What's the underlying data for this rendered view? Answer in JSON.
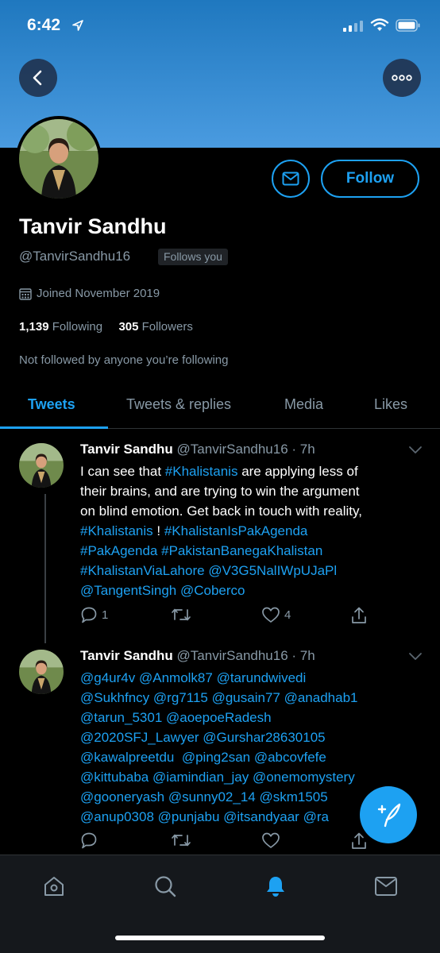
{
  "status_bar": {
    "time": "6:42"
  },
  "profile": {
    "name": "Tanvir Sandhu",
    "handle": "@TanvirSandhu16",
    "follows_you": "Follows you",
    "joined": "Joined November 2019",
    "following_count": "1,139",
    "following_label": "Following",
    "followers_count": "305",
    "followers_label": "Followers",
    "not_followed": "Not followed by anyone you’re following",
    "follow_button": "Follow"
  },
  "tabs": [
    {
      "label": "Tweets",
      "active": true
    },
    {
      "label": "Tweets & replies",
      "active": false
    },
    {
      "label": "Media",
      "active": false
    },
    {
      "label": "Likes",
      "active": false
    }
  ],
  "tweets": [
    {
      "author": "Tanvir Sandhu",
      "handle": "@TanvirSandhu16",
      "time": "· 7h",
      "lines": [
        [
          {
            "t": "I can see that "
          },
          {
            "t": "#Khalistanis",
            "link": true
          },
          {
            "t": " are applying less of"
          }
        ],
        [
          {
            "t": "their brains, and are trying to win the argument"
          }
        ],
        [
          {
            "t": "on blind emotion. Get back in touch with reality,"
          }
        ],
        [
          {
            "t": "#Khalistanis",
            "link": true
          },
          {
            "t": " ! "
          },
          {
            "t": "#KhalistanIsPakAgenda",
            "link": true
          }
        ],
        [
          {
            "t": "#PakAgenda",
            "link": true
          },
          {
            "t": " "
          },
          {
            "t": "#PakistanBanegaKhalistan",
            "link": true
          }
        ],
        [
          {
            "t": "#KhalistanViaLahore",
            "link": true
          },
          {
            "t": " "
          },
          {
            "t": "@V3G5NalIWpUJaPl",
            "link": true
          }
        ],
        [
          {
            "t": "@TangentSingh",
            "link": true
          },
          {
            "t": " "
          },
          {
            "t": "@Coberco",
            "link": true
          }
        ]
      ],
      "reply_count": "1",
      "retweet_count": "",
      "like_count": "4"
    },
    {
      "author": "Tanvir Sandhu",
      "handle": "@TanvirSandhu16",
      "time": "· 7h",
      "lines": [
        [
          {
            "t": "@g4ur4v",
            "link": true
          },
          {
            "t": " "
          },
          {
            "t": "@Anmolk87",
            "link": true
          },
          {
            "t": " "
          },
          {
            "t": "@tarundwivedi",
            "link": true
          }
        ],
        [
          {
            "t": "@Sukhfncy",
            "link": true
          },
          {
            "t": " "
          },
          {
            "t": "@rg7115",
            "link": true
          },
          {
            "t": " "
          },
          {
            "t": "@gusain77",
            "link": true
          },
          {
            "t": " "
          },
          {
            "t": "@anadhab1",
            "link": true
          }
        ],
        [
          {
            "t": "@tarun_5301",
            "link": true
          },
          {
            "t": " "
          },
          {
            "t": "@aoepoeRadesh",
            "link": true
          }
        ],
        [
          {
            "t": "@2020SFJ_Lawyer",
            "link": true
          },
          {
            "t": " "
          },
          {
            "t": "@Gurshar28630105",
            "link": true
          }
        ],
        [
          {
            "t": "@kawalpreetdu",
            "link": true
          },
          {
            "t": "  "
          },
          {
            "t": "@ping2san",
            "link": true
          },
          {
            "t": " "
          },
          {
            "t": "@abcovfefe",
            "link": true
          }
        ],
        [
          {
            "t": "@kittubaba",
            "link": true
          },
          {
            "t": " "
          },
          {
            "t": "@iamindian_jay",
            "link": true
          },
          {
            "t": " "
          },
          {
            "t": "@onemomystery",
            "link": true
          }
        ],
        [
          {
            "t": "@gooneryash",
            "link": true
          },
          {
            "t": " "
          },
          {
            "t": "@sunny02_14",
            "link": true
          },
          {
            "t": " "
          },
          {
            "t": "@skm1505",
            "link": true
          }
        ],
        [
          {
            "t": "@anup0308",
            "link": true
          },
          {
            "t": " "
          },
          {
            "t": "@punjabu",
            "link": true
          },
          {
            "t": " "
          },
          {
            "t": "@itsandyaar",
            "link": true
          },
          {
            "t": " "
          },
          {
            "t": "@ra",
            "link": true
          }
        ]
      ],
      "reply_count": "",
      "retweet_count": "",
      "like_count": ""
    }
  ],
  "colors": {
    "accent": "#1da1f2",
    "background": "#000000",
    "secondary_text": "#8899a6",
    "banner": "#3d8fd6"
  },
  "icons": {
    "back": "chevron-left-icon",
    "more": "more-dots-icon",
    "message": "envelope-icon",
    "calendar": "calendar-icon",
    "reply": "reply-icon",
    "retweet": "retweet-icon",
    "like": "heart-icon",
    "share": "share-icon",
    "compose": "compose-tweet-icon",
    "nav": [
      "home-icon",
      "search-icon",
      "notifications-icon",
      "messages-icon"
    ]
  }
}
